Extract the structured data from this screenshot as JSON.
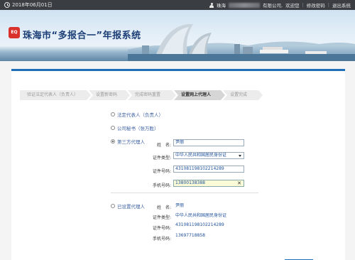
{
  "topbar": {
    "date": "2018年06月01日",
    "company_prefix": "珠海",
    "company_suffix": "有限公司,",
    "greeting": "欢迎您",
    "change_password": "修改密码",
    "logout": "退出系统",
    "separator": "|"
  },
  "banner": {
    "logo_text": "EQ",
    "title": "珠海市“多报合一”年报系统"
  },
  "steps": [
    {
      "label": "验证法定代表人（负责人）"
    },
    {
      "label": "设置新密码"
    },
    {
      "label": "完成密码重置"
    },
    {
      "label": "设置网上代理人"
    },
    {
      "label": "设置完成"
    }
  ],
  "options": {
    "legal_rep": "法定代表人（负责人）",
    "finance": "公司秘书（张万胜）",
    "third_party": "第三方代理人",
    "already_set": "已设置代理人"
  },
  "form": {
    "name_label": "姓　名:",
    "name_value": "尹丽",
    "id_type_label": "证件类型:",
    "id_type_value": "中华人民共和国居民身份证",
    "id_no_label": "证件号码:",
    "id_no_value": "431081198102214289",
    "phone_label": "手机号码:",
    "phone_value": "13800138388"
  },
  "existing": {
    "name_label": "姓　名:",
    "name_value": "尹丽",
    "id_type_label": "证件类型:",
    "id_type_value": "中华人民共和国居民身份证",
    "id_no_label": "证件号码:",
    "id_no_value": "431081198102214289",
    "phone_label": "手机号码:",
    "phone_value": "13697718858"
  },
  "icons": {
    "clock": "clock-icon",
    "user": "user-icon",
    "caret": "chevron-down-icon",
    "clear": "close-icon"
  },
  "colors": {
    "accent": "#1f6fb8",
    "brand_red": "#d9322c",
    "title_blue": "#1d3f77"
  }
}
